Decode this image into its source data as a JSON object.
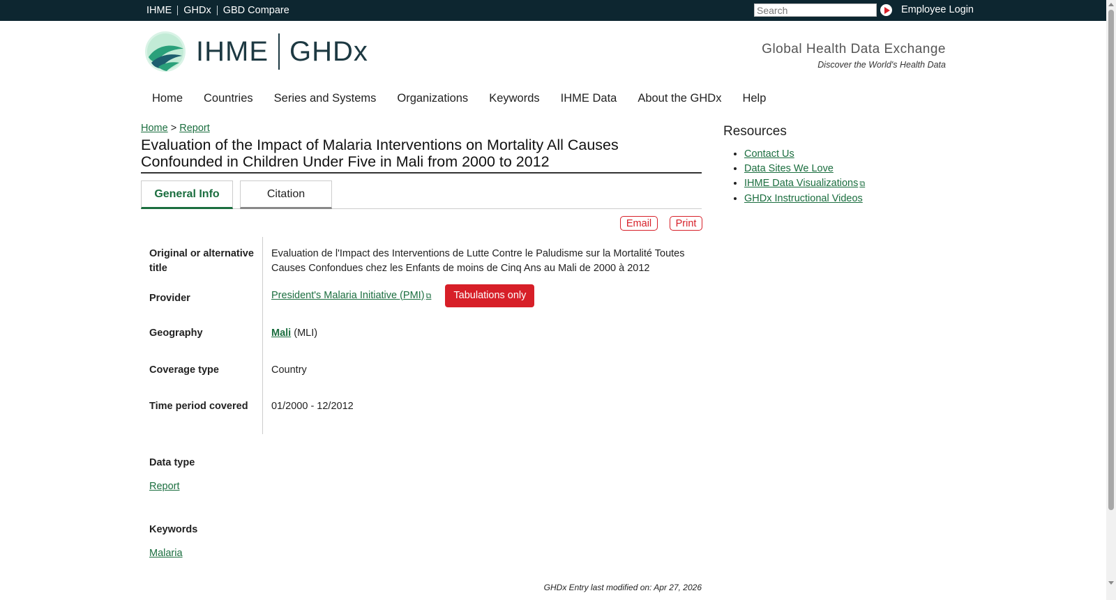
{
  "topnav": {
    "links": [
      "IHME",
      "GHDx",
      "GBD Compare"
    ],
    "search_placeholder": "Search",
    "employee_login": "Employee Login"
  },
  "header": {
    "logo_left": "IHME",
    "logo_right": "GHDx",
    "tagline": "Global Health Data Exchange",
    "subtagline": "Discover the World's Health Data"
  },
  "mainnav": [
    "Home",
    "Countries",
    "Series and Systems",
    "Organizations",
    "Keywords",
    "IHME Data",
    "About the GHDx",
    "Help"
  ],
  "breadcrumb": {
    "home": "Home",
    "sep": ">",
    "current": "Report"
  },
  "title": "Evaluation of the Impact of Malaria Interventions on Mortality All Causes Confounded in Children Under Five in Mali from 2000 to 2012",
  "tabs": [
    "General Info",
    "Citation"
  ],
  "actions": {
    "email": "Email",
    "print": "Print"
  },
  "info": {
    "original_title_label": "Original or alternative title",
    "original_title_value": "Evaluation de l'Impact des Interventions de Lutte Contre le Paludisme sur la Mortalité Toutes Causes Confondues chez les Enfants de moins de Cinq Ans au Mali de 2000 à 2012",
    "provider_label": "Provider",
    "provider_value": "President's Malaria Initiative (PMI)",
    "provider_badge": "Tabulations only",
    "geography_label": "Geography",
    "geography_link": "Mali",
    "geography_code": "(MLI)",
    "coverage_label": "Coverage type",
    "coverage_value": "Country",
    "time_label": "Time period covered",
    "time_value": "01/2000 - 12/2012"
  },
  "data_type": {
    "label": "Data type",
    "value": "Report"
  },
  "keywords": {
    "label": "Keywords",
    "value": "Malaria"
  },
  "modified": "GHDx Entry last modified on: Apr 27, 2026",
  "resources": {
    "title": "Resources",
    "items": [
      "Contact Us",
      "Data Sites We Love",
      "IHME Data Visualizations",
      "GHDx Instructional Videos"
    ]
  },
  "colors": {
    "topbar": "#0d2630",
    "link": "#1b6e3f",
    "accent_red": "#d71f28"
  }
}
